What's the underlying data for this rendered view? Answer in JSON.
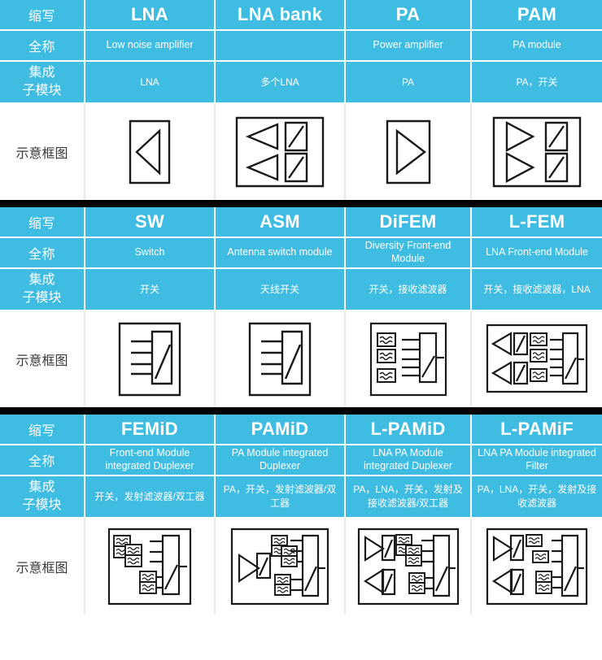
{
  "theme": {
    "accent": "#3fbce2",
    "separator": "#000000",
    "text_on_accent": "#ffffff",
    "diagram_stroke": "#1a1a1a",
    "grid_line": "#ffffff"
  },
  "row_labels": {
    "abbreviation": "缩写",
    "full_name": "全称",
    "submodules": "集成\n子模块",
    "submodules_line1": "集成",
    "submodules_line2": "子模块",
    "diagram": "示意框图"
  },
  "blocks": [
    {
      "id": "block-1",
      "columns": [
        {
          "abbr": "LNA",
          "full": "Low noise amplifier",
          "sub": "LNA",
          "diagram": "lna"
        },
        {
          "abbr": "LNA bank",
          "full": "",
          "sub": "多个LNA",
          "diagram": "lna-bank"
        },
        {
          "abbr": "PA",
          "full": "Power amplifier",
          "sub": "PA",
          "diagram": "pa"
        },
        {
          "abbr": "PAM",
          "full": "PA module",
          "sub": "PA，开关",
          "diagram": "pam"
        }
      ]
    },
    {
      "id": "block-2",
      "columns": [
        {
          "abbr": "SW",
          "full": "Switch",
          "sub": "开关",
          "diagram": "sw"
        },
        {
          "abbr": "ASM",
          "full": "Antenna switch module",
          "sub": "天线开关",
          "diagram": "asm"
        },
        {
          "abbr": "DiFEM",
          "full": "Diversity Front-end Module",
          "sub": "开关，接收滤波器",
          "diagram": "difem"
        },
        {
          "abbr": "L-FEM",
          "full": "LNA Front-end Module",
          "sub": "开关，接收滤波器，LNA",
          "diagram": "lfem"
        }
      ]
    },
    {
      "id": "block-3",
      "columns": [
        {
          "abbr": "FEMiD",
          "full": "Front-end Module integrated Duplexer",
          "sub": "开关，发射滤波器/双工器",
          "diagram": "femid"
        },
        {
          "abbr": "PAMiD",
          "full": "PA Module integrated Duplexer",
          "sub": "PA，开关，发射滤波器/双工器",
          "diagram": "pamid"
        },
        {
          "abbr": "L-PAMiD",
          "full": "LNA PA Module integrated Duplexer",
          "sub": "PA，LNA，开关，发射及接收滤波器/双工器",
          "diagram": "lpamid"
        },
        {
          "abbr": "L-PAMiF",
          "full": "LNA PA Module integrated Filter",
          "sub": "PA，LNA，开关，发射及接收滤波器",
          "diagram": "lpamif"
        }
      ]
    }
  ],
  "diagram_symbols": {
    "lna": "left-pointing-amplifier-triangle-in-box",
    "pa": "right-pointing-amplifier-triangle-in-box",
    "switch": "rectangle-with-diagonal-throw",
    "filter": "small-box-with-wavy-lines",
    "duplexer": "two-stacked-filter-boxes"
  }
}
